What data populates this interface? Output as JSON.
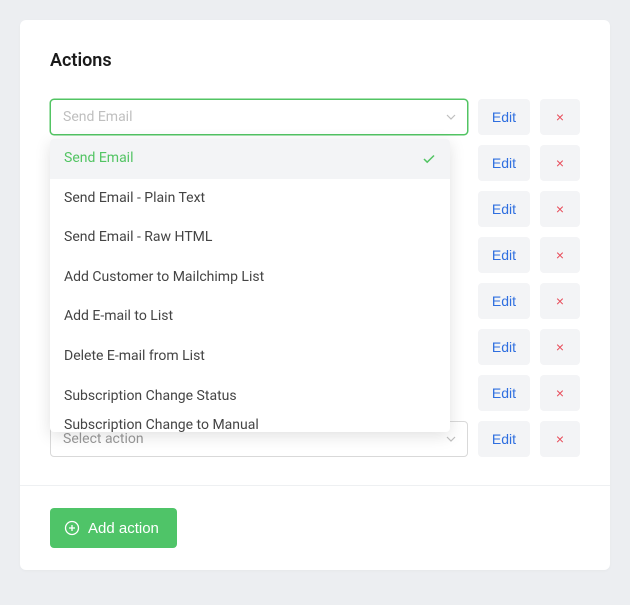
{
  "card": {
    "title": "Actions"
  },
  "select": {
    "placeholder": "Select action",
    "open_value": "Send Email"
  },
  "dropdown": {
    "options": [
      "Send Email",
      "Send Email - Plain Text",
      "Send Email - Raw HTML",
      "Add Customer to Mailchimp List",
      "Add E-mail to List",
      "Delete E-mail from List",
      "Subscription Change Status",
      "Subscription Change to Manual"
    ],
    "selected_index": 0
  },
  "buttons": {
    "edit": "Edit",
    "delete": "×",
    "add_action": "Add action"
  },
  "ghost": {
    "label": "Select action"
  }
}
